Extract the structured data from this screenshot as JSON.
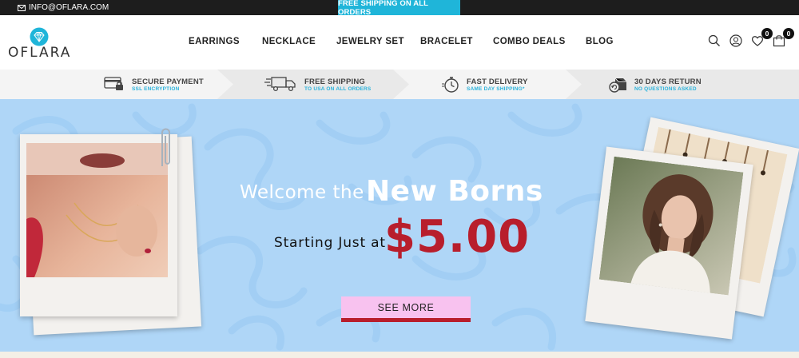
{
  "topbar": {
    "email": "INFO@OFLARA.COM",
    "promo": "FREE SHIPPING ON ALL ORDERS"
  },
  "brand": {
    "name": "OFLARA"
  },
  "nav": {
    "items": [
      "EARRINGS",
      "NECKLACE",
      "JEWELRY SET",
      "BRACELET",
      "COMBO DEALS",
      "BLOG"
    ]
  },
  "header_icons": {
    "search": "search-icon",
    "account": "user-icon",
    "wishlist": "heart-icon",
    "wishlist_count": "0",
    "cart": "cart-icon",
    "cart_count": "0"
  },
  "features": [
    {
      "icon": "credit-card-lock-icon",
      "title": "SECURE PAYMENT",
      "subtitle": "SSL ENCRYPTION"
    },
    {
      "icon": "delivery-truck-icon",
      "title": "FREE SHIPPING",
      "subtitle": "TO USA ON ALL ORDERS"
    },
    {
      "icon": "stopwatch-icon",
      "title": "FAST DELIVERY",
      "subtitle": "SAME DAY SHIPPING*"
    },
    {
      "icon": "return-box-icon",
      "title": "30 DAYS RETURN",
      "subtitle": "NO QUESTIONS ASKED"
    }
  ],
  "hero": {
    "headline_thin": "Welcome the",
    "headline_bold": "New Borns",
    "subline": "Starting Just at",
    "price": "$5.00",
    "cta": "SEE MORE"
  },
  "colors": {
    "topbar_bg": "#1d1d1d",
    "accent": "#1fb5d9",
    "hero_bg": "#afd6f7",
    "price_red": "#b81e2c",
    "cta_pink": "#f8c2ef"
  }
}
